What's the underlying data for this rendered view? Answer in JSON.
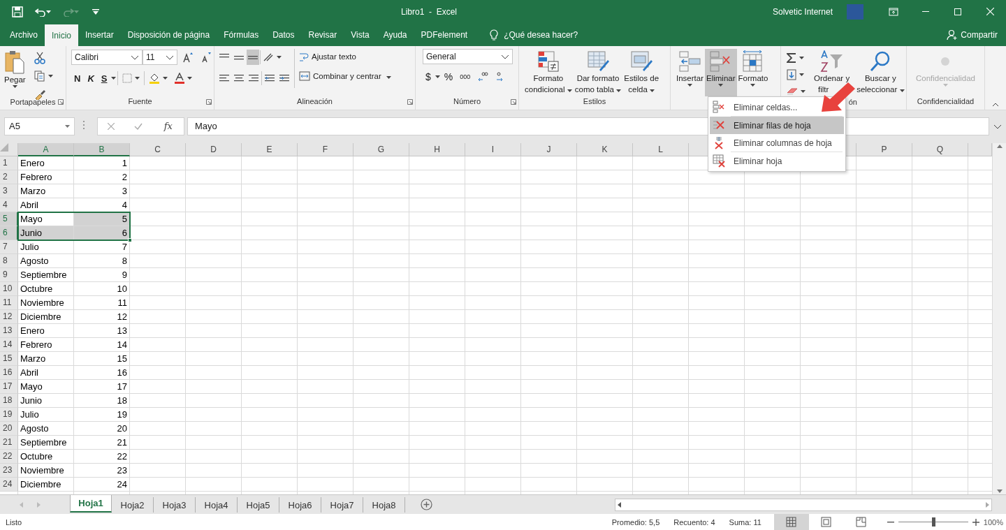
{
  "title_bar": {
    "title": "Libro1  -  Excel",
    "user": "Solvetic Internet"
  },
  "menu_tabs": [
    {
      "label": "Archivo",
      "selected": false
    },
    {
      "label": "Inicio",
      "selected": true
    },
    {
      "label": "Insertar",
      "selected": false
    },
    {
      "label": "Disposición de página",
      "selected": false
    },
    {
      "label": "Fórmulas",
      "selected": false
    },
    {
      "label": "Datos",
      "selected": false
    },
    {
      "label": "Revisar",
      "selected": false
    },
    {
      "label": "Vista",
      "selected": false
    },
    {
      "label": "Ayuda",
      "selected": false
    },
    {
      "label": "PDFelement",
      "selected": false
    }
  ],
  "tell_me": "¿Qué desea hacer?",
  "share": "Compartir",
  "ribbon": {
    "clipboard": {
      "label": "Portapapeles",
      "paste": "Pegar"
    },
    "font": {
      "label": "Fuente",
      "font_name": "Calibri",
      "font_size": "11",
      "bold": "N",
      "italic": "K",
      "underline": "S"
    },
    "alignment": {
      "label": "Alineación",
      "wrap": "Ajustar texto",
      "merge": "Combinar y centrar"
    },
    "number": {
      "label": "Número",
      "format": "General",
      "currency": "$",
      "percent": "%",
      "thousands": "000"
    },
    "styles": {
      "label": "Estilos",
      "buttons": [
        [
          "Formato",
          "condicional"
        ],
        [
          "Dar formato",
          "como tabla"
        ],
        [
          "Estilos de",
          "celda"
        ]
      ]
    },
    "cells": {
      "buttons": [
        {
          "label": "Insertar",
          "selected": false
        },
        {
          "label": "Eliminar",
          "selected": true
        },
        {
          "label": "Formato",
          "selected": false
        }
      ]
    },
    "editing": {
      "label": "ón",
      "sort": [
        "Ordenar y",
        "filtr"
      ],
      "find": [
        "Buscar y",
        "seleccionar"
      ]
    },
    "sensitivity": {
      "button": "Confidencialidad",
      "label": "Confidencialidad",
      "disabled": true
    }
  },
  "delete_menu": [
    {
      "label": "Eliminar celdas...",
      "selected": false
    },
    {
      "label": "Eliminar filas de hoja",
      "selected": true
    },
    {
      "label": "Eliminar columnas de hoja",
      "selected": false
    },
    {
      "label": "Eliminar hoja",
      "selected": false
    }
  ],
  "formula_bar": {
    "name_box": "A5",
    "fx": "fx",
    "formula": "Mayo"
  },
  "columns": [
    {
      "label": "A",
      "selected": true
    },
    {
      "label": "B",
      "selected": true
    },
    {
      "label": "C",
      "selected": false
    },
    {
      "label": "D",
      "selected": false
    },
    {
      "label": "E",
      "selected": false
    },
    {
      "label": "F",
      "selected": false
    },
    {
      "label": "G",
      "selected": false
    },
    {
      "label": "H",
      "selected": false
    },
    {
      "label": "I",
      "selected": false
    },
    {
      "label": "J",
      "selected": false
    },
    {
      "label": "K",
      "selected": false
    },
    {
      "label": "L",
      "selected": false
    },
    {},
    {},
    {},
    {
      "label": "P",
      "selected": false
    },
    {
      "label": "Q",
      "selected": false
    }
  ],
  "rows": [
    {
      "number": "1",
      "selected": false,
      "cells": [
        {
          "text": "Enero",
          "kind": "text",
          "highlighted": false
        },
        {
          "text": "1",
          "kind": "number",
          "highlighted": false
        }
      ]
    },
    {
      "number": "2",
      "selected": false,
      "cells": [
        {
          "text": "Febrero",
          "kind": "text",
          "highlighted": false
        },
        {
          "text": "2",
          "kind": "number",
          "highlighted": false
        }
      ]
    },
    {
      "number": "3",
      "selected": false,
      "cells": [
        {
          "text": "Marzo",
          "kind": "text",
          "highlighted": false
        },
        {
          "text": "3",
          "kind": "number",
          "highlighted": false
        }
      ]
    },
    {
      "number": "4",
      "selected": false,
      "cells": [
        {
          "text": "Abril",
          "kind": "text",
          "highlighted": false
        },
        {
          "text": "4",
          "kind": "number",
          "highlighted": false
        }
      ]
    },
    {
      "number": "5",
      "selected": true,
      "cells": [
        {
          "text": "Mayo",
          "kind": "text",
          "highlighted": false
        },
        {
          "text": "5",
          "kind": "number",
          "highlighted": true
        }
      ]
    },
    {
      "number": "6",
      "selected": true,
      "cells": [
        {
          "text": "Junio",
          "kind": "text",
          "highlighted": true
        },
        {
          "text": "6",
          "kind": "number",
          "highlighted": true
        }
      ]
    },
    {
      "number": "7",
      "selected": false,
      "cells": [
        {
          "text": "Julio",
          "kind": "text",
          "highlighted": false
        },
        {
          "text": "7",
          "kind": "number",
          "highlighted": false
        }
      ]
    },
    {
      "number": "8",
      "selected": false,
      "cells": [
        {
          "text": "Agosto",
          "kind": "text",
          "highlighted": false
        },
        {
          "text": "8",
          "kind": "number",
          "highlighted": false
        }
      ]
    },
    {
      "number": "9",
      "selected": false,
      "cells": [
        {
          "text": "Septiembre",
          "kind": "text",
          "highlighted": false
        },
        {
          "text": "9",
          "kind": "number",
          "highlighted": false
        }
      ]
    },
    {
      "number": "10",
      "selected": false,
      "cells": [
        {
          "text": "Octubre",
          "kind": "text",
          "highlighted": false
        },
        {
          "text": "10",
          "kind": "number",
          "highlighted": false
        }
      ]
    },
    {
      "number": "11",
      "selected": false,
      "cells": [
        {
          "text": "Noviembre",
          "kind": "text",
          "highlighted": false
        },
        {
          "text": "11",
          "kind": "number",
          "highlighted": false
        }
      ]
    },
    {
      "number": "12",
      "selected": false,
      "cells": [
        {
          "text": "Diciembre",
          "kind": "text",
          "highlighted": false
        },
        {
          "text": "12",
          "kind": "number",
          "highlighted": false
        }
      ]
    },
    {
      "number": "13",
      "selected": false,
      "cells": [
        {
          "text": "Enero",
          "kind": "text",
          "highlighted": false
        },
        {
          "text": "13",
          "kind": "number",
          "highlighted": false
        }
      ]
    },
    {
      "number": "14",
      "selected": false,
      "cells": [
        {
          "text": "Febrero",
          "kind": "text",
          "highlighted": false
        },
        {
          "text": "14",
          "kind": "number",
          "highlighted": false
        }
      ]
    },
    {
      "number": "15",
      "selected": false,
      "cells": [
        {
          "text": "Marzo",
          "kind": "text",
          "highlighted": false
        },
        {
          "text": "15",
          "kind": "number",
          "highlighted": false
        }
      ]
    },
    {
      "number": "16",
      "selected": false,
      "cells": [
        {
          "text": "Abril",
          "kind": "text",
          "highlighted": false
        },
        {
          "text": "16",
          "kind": "number",
          "highlighted": false
        }
      ]
    },
    {
      "number": "17",
      "selected": false,
      "cells": [
        {
          "text": "Mayo",
          "kind": "text",
          "highlighted": false
        },
        {
          "text": "17",
          "kind": "number",
          "highlighted": false
        }
      ]
    },
    {
      "number": "18",
      "selected": false,
      "cells": [
        {
          "text": "Junio",
          "kind": "text",
          "highlighted": false
        },
        {
          "text": "18",
          "kind": "number",
          "highlighted": false
        }
      ]
    },
    {
      "number": "19",
      "selected": false,
      "cells": [
        {
          "text": "Julio",
          "kind": "text",
          "highlighted": false
        },
        {
          "text": "19",
          "kind": "number",
          "highlighted": false
        }
      ]
    },
    {
      "number": "20",
      "selected": false,
      "cells": [
        {
          "text": "Agosto",
          "kind": "text",
          "highlighted": false
        },
        {
          "text": "20",
          "kind": "number",
          "highlighted": false
        }
      ]
    },
    {
      "number": "21",
      "selected": false,
      "cells": [
        {
          "text": "Septiembre",
          "kind": "text",
          "highlighted": false
        },
        {
          "text": "21",
          "kind": "number",
          "highlighted": false
        }
      ]
    },
    {
      "number": "22",
      "selected": false,
      "cells": [
        {
          "text": "Octubre",
          "kind": "text",
          "highlighted": false
        },
        {
          "text": "22",
          "kind": "number",
          "highlighted": false
        }
      ]
    },
    {
      "number": "23",
      "selected": false,
      "cells": [
        {
          "text": "Noviembre",
          "kind": "text",
          "highlighted": false
        },
        {
          "text": "23",
          "kind": "number",
          "highlighted": false
        }
      ]
    },
    {
      "number": "24",
      "selected": false,
      "cells": [
        {
          "text": "Diciembre",
          "kind": "text",
          "highlighted": false
        },
        {
          "text": "24",
          "kind": "number",
          "highlighted": false
        }
      ]
    }
  ],
  "sheet_tabs": [
    {
      "label": "Hoja1",
      "selected": true
    },
    {
      "label": "Hoja2",
      "selected": false
    },
    {
      "label": "Hoja3",
      "selected": false
    },
    {
      "label": "Hoja4",
      "selected": false
    },
    {
      "label": "Hoja5",
      "selected": false
    },
    {
      "label": "Hoja6",
      "selected": false
    },
    {
      "label": "Hoja7",
      "selected": false
    },
    {
      "label": "Hoja8",
      "selected": false
    }
  ],
  "status_bar": {
    "status": "Listo",
    "stats": [
      "Promedio: 5,5",
      "Recuento: 4",
      "Suma: 11"
    ],
    "view_modes": [
      {
        "selected": true
      },
      {
        "selected": false
      },
      {
        "selected": false
      }
    ],
    "zoom": {
      "level": 0.5,
      "reading": "100%"
    }
  }
}
